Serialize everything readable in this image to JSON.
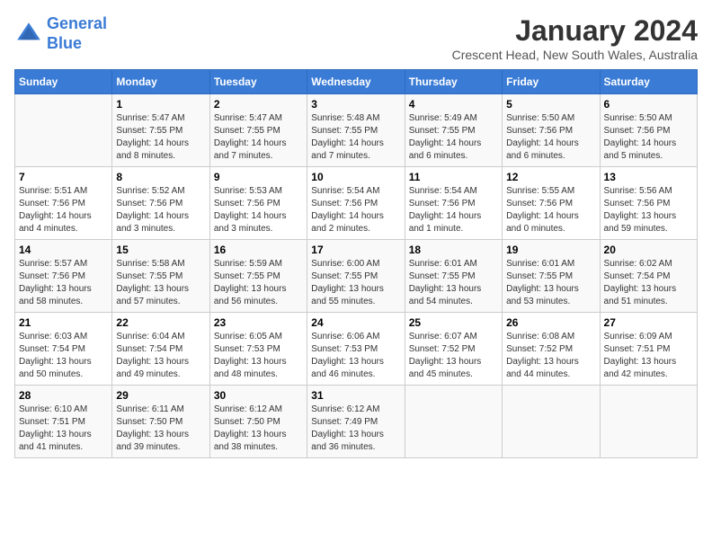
{
  "header": {
    "logo_line1": "General",
    "logo_line2": "Blue",
    "month_title": "January 2024",
    "location": "Crescent Head, New South Wales, Australia"
  },
  "days_of_week": [
    "Sunday",
    "Monday",
    "Tuesday",
    "Wednesday",
    "Thursday",
    "Friday",
    "Saturday"
  ],
  "weeks": [
    [
      {
        "day": "",
        "content": ""
      },
      {
        "day": "1",
        "content": "Sunrise: 5:47 AM\nSunset: 7:55 PM\nDaylight: 14 hours\nand 8 minutes."
      },
      {
        "day": "2",
        "content": "Sunrise: 5:47 AM\nSunset: 7:55 PM\nDaylight: 14 hours\nand 7 minutes."
      },
      {
        "day": "3",
        "content": "Sunrise: 5:48 AM\nSunset: 7:55 PM\nDaylight: 14 hours\nand 7 minutes."
      },
      {
        "day": "4",
        "content": "Sunrise: 5:49 AM\nSunset: 7:55 PM\nDaylight: 14 hours\nand 6 minutes."
      },
      {
        "day": "5",
        "content": "Sunrise: 5:50 AM\nSunset: 7:56 PM\nDaylight: 14 hours\nand 6 minutes."
      },
      {
        "day": "6",
        "content": "Sunrise: 5:50 AM\nSunset: 7:56 PM\nDaylight: 14 hours\nand 5 minutes."
      }
    ],
    [
      {
        "day": "7",
        "content": "Sunrise: 5:51 AM\nSunset: 7:56 PM\nDaylight: 14 hours\nand 4 minutes."
      },
      {
        "day": "8",
        "content": "Sunrise: 5:52 AM\nSunset: 7:56 PM\nDaylight: 14 hours\nand 3 minutes."
      },
      {
        "day": "9",
        "content": "Sunrise: 5:53 AM\nSunset: 7:56 PM\nDaylight: 14 hours\nand 3 minutes."
      },
      {
        "day": "10",
        "content": "Sunrise: 5:54 AM\nSunset: 7:56 PM\nDaylight: 14 hours\nand 2 minutes."
      },
      {
        "day": "11",
        "content": "Sunrise: 5:54 AM\nSunset: 7:56 PM\nDaylight: 14 hours\nand 1 minute."
      },
      {
        "day": "12",
        "content": "Sunrise: 5:55 AM\nSunset: 7:56 PM\nDaylight: 14 hours\nand 0 minutes."
      },
      {
        "day": "13",
        "content": "Sunrise: 5:56 AM\nSunset: 7:56 PM\nDaylight: 13 hours\nand 59 minutes."
      }
    ],
    [
      {
        "day": "14",
        "content": "Sunrise: 5:57 AM\nSunset: 7:56 PM\nDaylight: 13 hours\nand 58 minutes."
      },
      {
        "day": "15",
        "content": "Sunrise: 5:58 AM\nSunset: 7:55 PM\nDaylight: 13 hours\nand 57 minutes."
      },
      {
        "day": "16",
        "content": "Sunrise: 5:59 AM\nSunset: 7:55 PM\nDaylight: 13 hours\nand 56 minutes."
      },
      {
        "day": "17",
        "content": "Sunrise: 6:00 AM\nSunset: 7:55 PM\nDaylight: 13 hours\nand 55 minutes."
      },
      {
        "day": "18",
        "content": "Sunrise: 6:01 AM\nSunset: 7:55 PM\nDaylight: 13 hours\nand 54 minutes."
      },
      {
        "day": "19",
        "content": "Sunrise: 6:01 AM\nSunset: 7:55 PM\nDaylight: 13 hours\nand 53 minutes."
      },
      {
        "day": "20",
        "content": "Sunrise: 6:02 AM\nSunset: 7:54 PM\nDaylight: 13 hours\nand 51 minutes."
      }
    ],
    [
      {
        "day": "21",
        "content": "Sunrise: 6:03 AM\nSunset: 7:54 PM\nDaylight: 13 hours\nand 50 minutes."
      },
      {
        "day": "22",
        "content": "Sunrise: 6:04 AM\nSunset: 7:54 PM\nDaylight: 13 hours\nand 49 minutes."
      },
      {
        "day": "23",
        "content": "Sunrise: 6:05 AM\nSunset: 7:53 PM\nDaylight: 13 hours\nand 48 minutes."
      },
      {
        "day": "24",
        "content": "Sunrise: 6:06 AM\nSunset: 7:53 PM\nDaylight: 13 hours\nand 46 minutes."
      },
      {
        "day": "25",
        "content": "Sunrise: 6:07 AM\nSunset: 7:52 PM\nDaylight: 13 hours\nand 45 minutes."
      },
      {
        "day": "26",
        "content": "Sunrise: 6:08 AM\nSunset: 7:52 PM\nDaylight: 13 hours\nand 44 minutes."
      },
      {
        "day": "27",
        "content": "Sunrise: 6:09 AM\nSunset: 7:51 PM\nDaylight: 13 hours\nand 42 minutes."
      }
    ],
    [
      {
        "day": "28",
        "content": "Sunrise: 6:10 AM\nSunset: 7:51 PM\nDaylight: 13 hours\nand 41 minutes."
      },
      {
        "day": "29",
        "content": "Sunrise: 6:11 AM\nSunset: 7:50 PM\nDaylight: 13 hours\nand 39 minutes."
      },
      {
        "day": "30",
        "content": "Sunrise: 6:12 AM\nSunset: 7:50 PM\nDaylight: 13 hours\nand 38 minutes."
      },
      {
        "day": "31",
        "content": "Sunrise: 6:12 AM\nSunset: 7:49 PM\nDaylight: 13 hours\nand 36 minutes."
      },
      {
        "day": "",
        "content": ""
      },
      {
        "day": "",
        "content": ""
      },
      {
        "day": "",
        "content": ""
      }
    ]
  ]
}
